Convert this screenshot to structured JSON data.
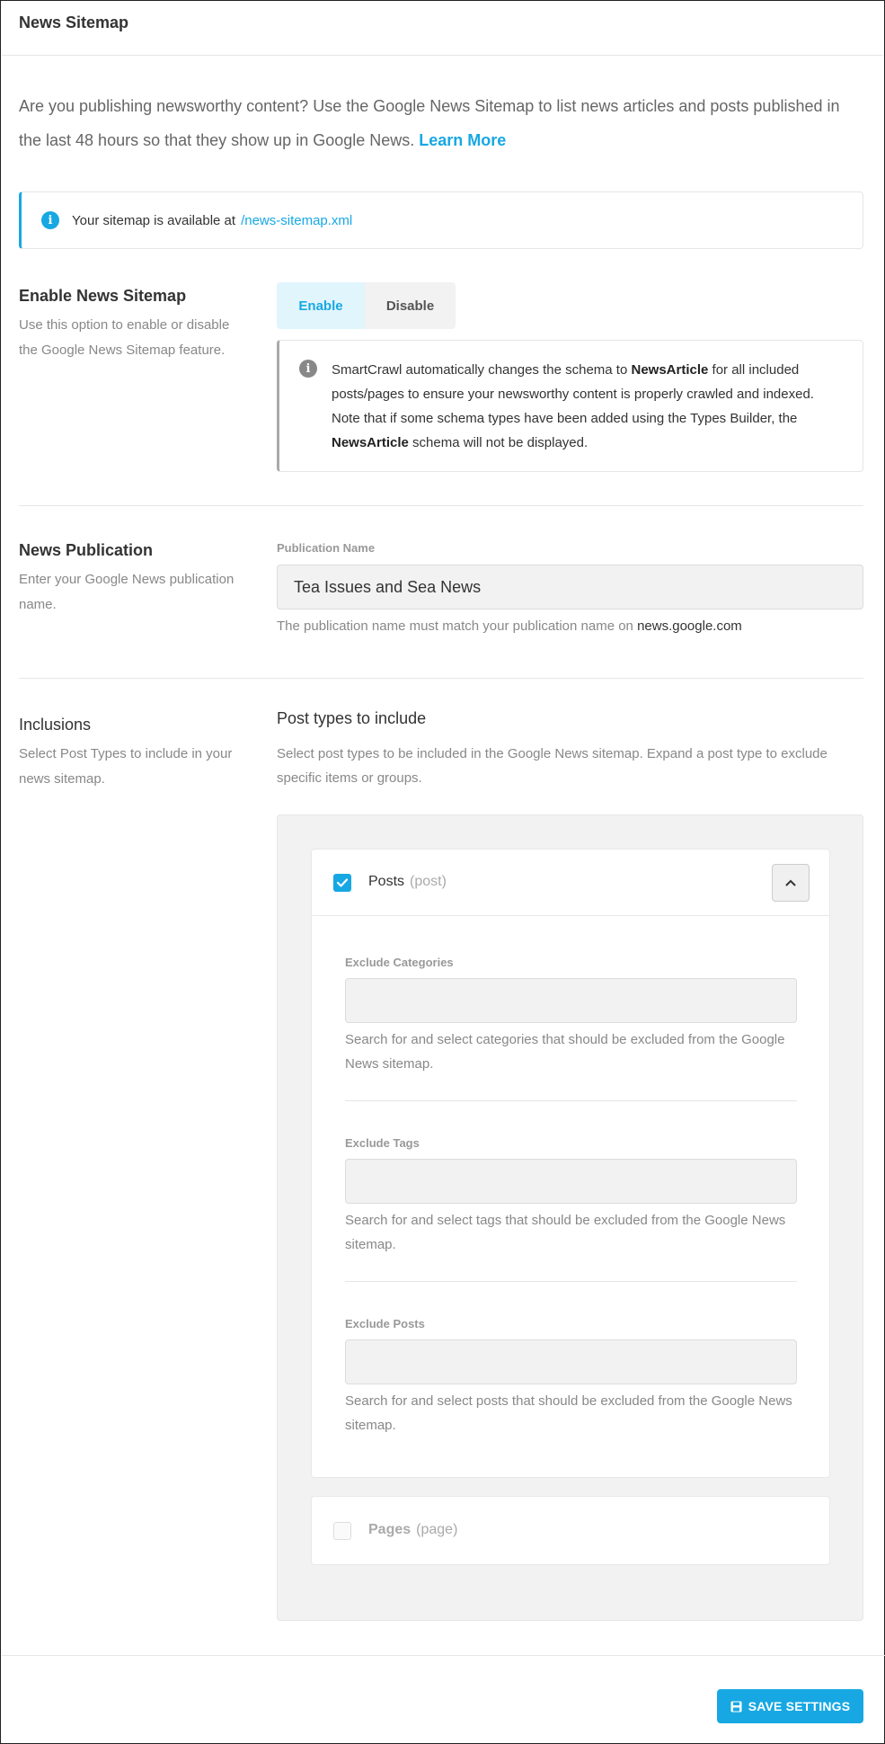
{
  "header": {
    "title": "News Sitemap"
  },
  "intro": {
    "text": "Are you publishing newsworthy content? Use the Google News Sitemap to list news articles and posts published in the last 48 hours so that they show up in Google News.",
    "link_label": "Learn More"
  },
  "notice": {
    "icon": "info-icon",
    "text": "Your sitemap is available at",
    "link": "/news-sitemap.xml"
  },
  "enable_section": {
    "title": "Enable News Sitemap",
    "description": "Use this option to enable or disable the Google News Sitemap feature.",
    "enable_label": "Enable",
    "disable_label": "Disable",
    "selected": "Enable",
    "schema_note": {
      "part1": "SmartCrawl automatically changes the schema to",
      "bold1": "NewsArticle",
      "part2": "for all included posts/pages to ensure your newsworthy content is properly crawled and indexed. Note that if some schema types have been added using the Types Builder, the",
      "bold2": "NewsArticle",
      "part3": "schema will not be displayed."
    }
  },
  "publication_section": {
    "title": "News Publication",
    "description": "Enter your Google News publication name.",
    "field_label": "Publication Name",
    "value": "Tea Issues and Sea News",
    "help_prefix": "The publication name must match your publication name on",
    "help_domain": "news.google.com"
  },
  "inclusions_section": {
    "title": "Inclusions",
    "description": "Select Post Types to include in your news sitemap.",
    "subtitle": "Post types to include",
    "help": "Select post types to be included in the Google News sitemap. Expand a post type to exclude specific items or groups.",
    "post_types": [
      {
        "name": "Posts",
        "slug": "(post)",
        "checked": true,
        "expanded": true,
        "exclusions": [
          {
            "label": "Exclude Categories",
            "value": "",
            "help": "Search for and select categories that should be excluded from the Google News sitemap."
          },
          {
            "label": "Exclude Tags",
            "value": "",
            "help": "Search for and select tags that should be excluded from the Google News sitemap."
          },
          {
            "label": "Exclude Posts",
            "value": "",
            "help": "Search for and select posts that should be excluded from the Google News sitemap."
          }
        ]
      },
      {
        "name": "Pages",
        "slug": "(page)",
        "checked": false,
        "expanded": false
      }
    ]
  },
  "footer": {
    "save_label": "SAVE SETTINGS",
    "save_icon": "save-icon"
  },
  "colors": {
    "accent": "#17a8e3",
    "muted_text": "#888888",
    "panel_bg": "#f2f2f2"
  }
}
